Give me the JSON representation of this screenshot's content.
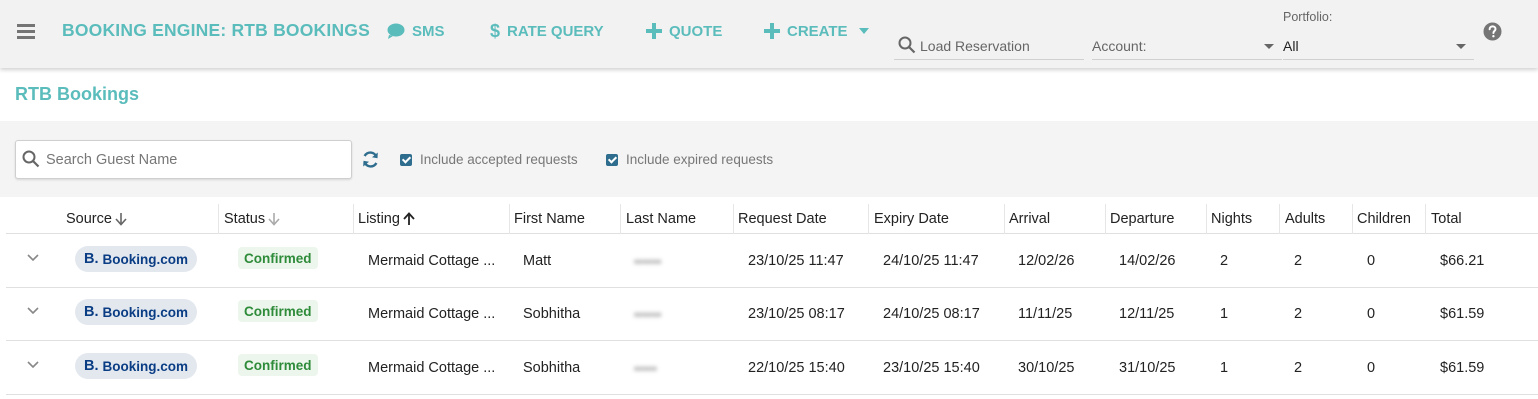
{
  "header": {
    "title": "BOOKING ENGINE: RTB BOOKINGS",
    "nav": {
      "sms": "SMS",
      "rate_query": "RATE QUERY",
      "quote": "QUOTE",
      "create": "CREATE"
    },
    "load_reservation_placeholder": "Load Reservation",
    "account_label": "Account:",
    "portfolio_label": "Portfolio:",
    "portfolio_value": "All"
  },
  "page": {
    "title": "RTB Bookings"
  },
  "filters": {
    "search_placeholder": "Search Guest Name",
    "include_accepted": "Include accepted requests",
    "include_expired": "Include expired requests"
  },
  "table": {
    "columns": {
      "source": "Source",
      "status": "Status",
      "listing": "Listing",
      "first_name": "First Name",
      "last_name": "Last Name",
      "request_date": "Request Date",
      "expiry_date": "Expiry Date",
      "arrival": "Arrival",
      "departure": "Departure",
      "nights": "Nights",
      "adults": "Adults",
      "children": "Children",
      "total": "Total"
    },
    "rows": [
      {
        "source_b": "B.",
        "source": "Booking.com",
        "status": "Confirmed",
        "listing": "Mermaid Cottage ...",
        "first_name": "Matt",
        "last_name": "••••••",
        "request_date": "23/10/25 11:47",
        "expiry_date": "24/10/25 11:47",
        "arrival": "12/02/26",
        "departure": "14/02/26",
        "nights": "2",
        "adults": "2",
        "children": "0",
        "total": "$66.21"
      },
      {
        "source_b": "B.",
        "source": "Booking.com",
        "status": "Confirmed",
        "listing": "Mermaid Cottage ...",
        "first_name": "Sobhitha",
        "last_name": "••••••",
        "request_date": "23/10/25 08:17",
        "expiry_date": "24/10/25 08:17",
        "arrival": "11/11/25",
        "departure": "12/11/25",
        "nights": "1",
        "adults": "2",
        "children": "0",
        "total": "$61.59"
      },
      {
        "source_b": "B.",
        "source": "Booking.com",
        "status": "Confirmed",
        "listing": "Mermaid Cottage ...",
        "first_name": "Sobhitha",
        "last_name": "•••••",
        "request_date": "22/10/25 15:40",
        "expiry_date": "23/10/25 15:40",
        "arrival": "30/10/25",
        "departure": "31/10/25",
        "nights": "1",
        "adults": "2",
        "children": "0",
        "total": "$61.59"
      }
    ]
  },
  "colors": {
    "accent": "#5bbcbc",
    "checkbox": "#2e6d8e",
    "confirmed": "#2e8b3a",
    "booking_brand": "#0a3d84"
  },
  "icons": {
    "menu": "hamburger-menu-icon",
    "sms": "chat-bubble-icon",
    "rate_query": "dollar-icon",
    "quote": "plus-icon",
    "create": "plus-icon",
    "search": "search-icon",
    "refresh": "refresh-icon",
    "help": "help-circle-icon",
    "expand": "chevron-down-icon"
  }
}
